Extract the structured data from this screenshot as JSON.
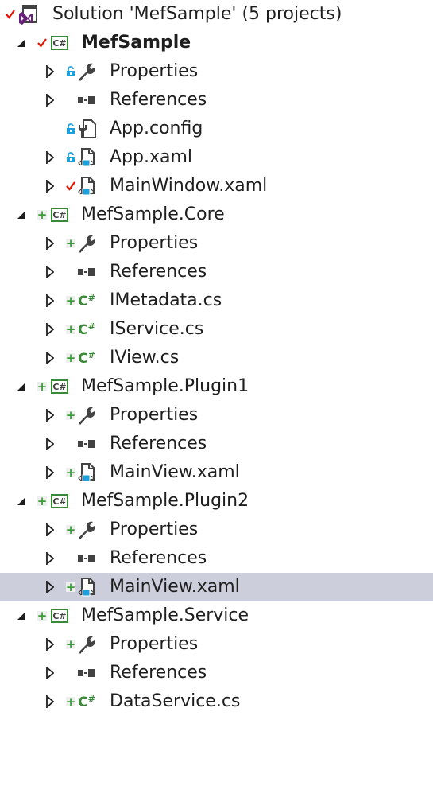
{
  "solution": {
    "label": "Solution 'MefSample' (5 projects)",
    "state": "checked-out",
    "icon": "visual-studio-solution-icon"
  },
  "colors": {
    "selection": "#cccedb",
    "added": "#3c9b3c",
    "checked": "#e51400",
    "locked": "#1ba1e2",
    "csharp": "#388a34"
  },
  "projects": [
    {
      "label": "MefSample",
      "bold": true,
      "state": "checked-out",
      "expanded": true,
      "items": [
        {
          "label": "Properties",
          "type": "properties",
          "state": "locked",
          "expandable": true
        },
        {
          "label": "References",
          "type": "references",
          "state": "none",
          "expandable": true
        },
        {
          "label": "App.config",
          "type": "config",
          "state": "locked",
          "expandable": false
        },
        {
          "label": "App.xaml",
          "type": "xaml",
          "state": "locked",
          "expandable": true
        },
        {
          "label": "MainWindow.xaml",
          "type": "xaml",
          "state": "checked-out",
          "expandable": true
        }
      ]
    },
    {
      "label": "MefSample.Core",
      "bold": false,
      "state": "added",
      "expanded": true,
      "items": [
        {
          "label": "Properties",
          "type": "properties",
          "state": "added",
          "expandable": true
        },
        {
          "label": "References",
          "type": "references",
          "state": "none",
          "expandable": true
        },
        {
          "label": "IMetadata.cs",
          "type": "cs",
          "state": "added",
          "expandable": true
        },
        {
          "label": "IService.cs",
          "type": "cs",
          "state": "added",
          "expandable": true
        },
        {
          "label": "IView.cs",
          "type": "cs",
          "state": "added",
          "expandable": true
        }
      ]
    },
    {
      "label": "MefSample.Plugin1",
      "bold": false,
      "state": "added",
      "expanded": true,
      "items": [
        {
          "label": "Properties",
          "type": "properties",
          "state": "added",
          "expandable": true
        },
        {
          "label": "References",
          "type": "references",
          "state": "none",
          "expandable": true
        },
        {
          "label": "MainView.xaml",
          "type": "xaml",
          "state": "added",
          "expandable": true
        }
      ]
    },
    {
      "label": "MefSample.Plugin2",
      "bold": false,
      "state": "added",
      "expanded": true,
      "items": [
        {
          "label": "Properties",
          "type": "properties",
          "state": "added",
          "expandable": true
        },
        {
          "label": "References",
          "type": "references",
          "state": "none",
          "expandable": true
        },
        {
          "label": "MainView.xaml",
          "type": "xaml",
          "state": "added",
          "expandable": true,
          "selected": true
        }
      ]
    },
    {
      "label": "MefSample.Service",
      "bold": false,
      "state": "added",
      "expanded": true,
      "items": [
        {
          "label": "Properties",
          "type": "properties",
          "state": "added",
          "expandable": true
        },
        {
          "label": "References",
          "type": "references",
          "state": "none",
          "expandable": true
        },
        {
          "label": "DataService.cs",
          "type": "cs",
          "state": "added",
          "expandable": true
        }
      ]
    }
  ]
}
